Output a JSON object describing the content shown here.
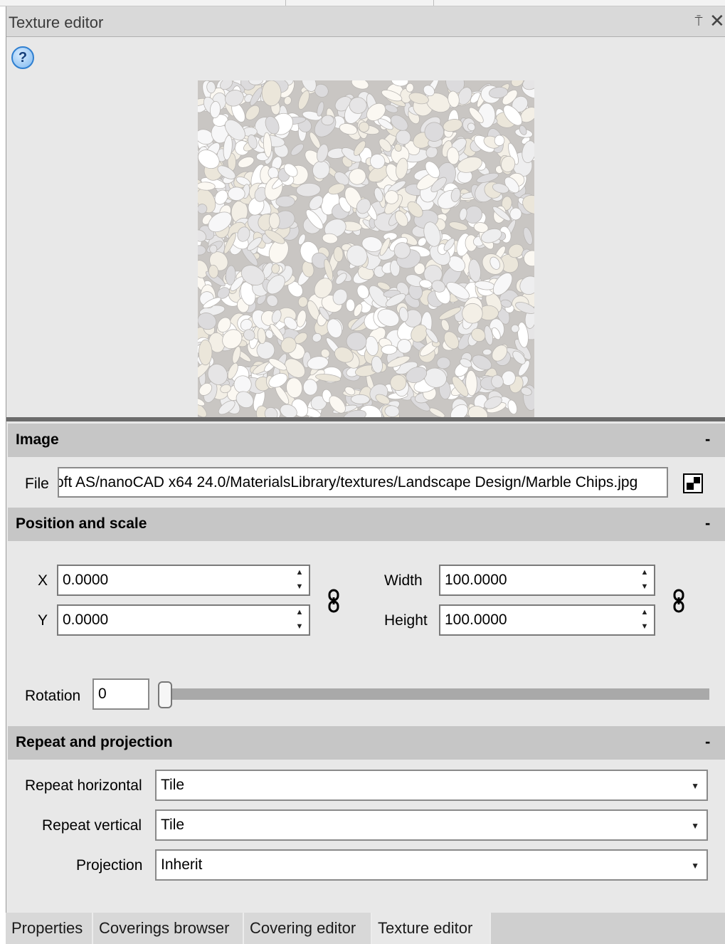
{
  "window": {
    "title": "Texture editor",
    "pin_glyph": "⍑",
    "close_glyph": "✕"
  },
  "help": {
    "glyph": "?",
    "icon": "help-icon"
  },
  "preview": {
    "image": "marble-chips-texture"
  },
  "image_section": {
    "title": "Image",
    "collapse_glyph": "-",
    "file_label": "File",
    "file_value": "oft AS/nanoCAD x64 24.0/MaterialsLibrary/textures/Landscape Design/Marble Chips.jpg",
    "browse_icon": "browse-file-icon"
  },
  "position_section": {
    "title": "Position and scale",
    "collapse_glyph": "-",
    "x_label": "X",
    "x_value": "0.0000",
    "y_label": "Y",
    "y_value": "0.0000",
    "width_label": "Width",
    "width_value": "100.0000",
    "height_label": "Height",
    "height_value": "100.0000",
    "rotation_label": "Rotation",
    "rotation_value": "0",
    "rotation_slider_fraction": 0
  },
  "repeat_section": {
    "title": "Repeat and projection",
    "collapse_glyph": "-",
    "repeat_h_label": "Repeat horizontal",
    "repeat_h_value": "Tile",
    "repeat_v_label": "Repeat vertical",
    "repeat_v_value": "Tile",
    "projection_label": "Projection",
    "projection_value": "Inherit"
  },
  "tabs": [
    {
      "label": "Properties",
      "active": false
    },
    {
      "label": "Coverings browser",
      "active": false
    },
    {
      "label": "Covering editor",
      "active": false
    },
    {
      "label": "Texture editor",
      "active": true
    }
  ],
  "colors": {
    "panel_bg": "#e8e8e8",
    "section_header": "#c6c6c6",
    "splitter": "#6b6b6b",
    "help_blue": "#2f7fd0"
  }
}
